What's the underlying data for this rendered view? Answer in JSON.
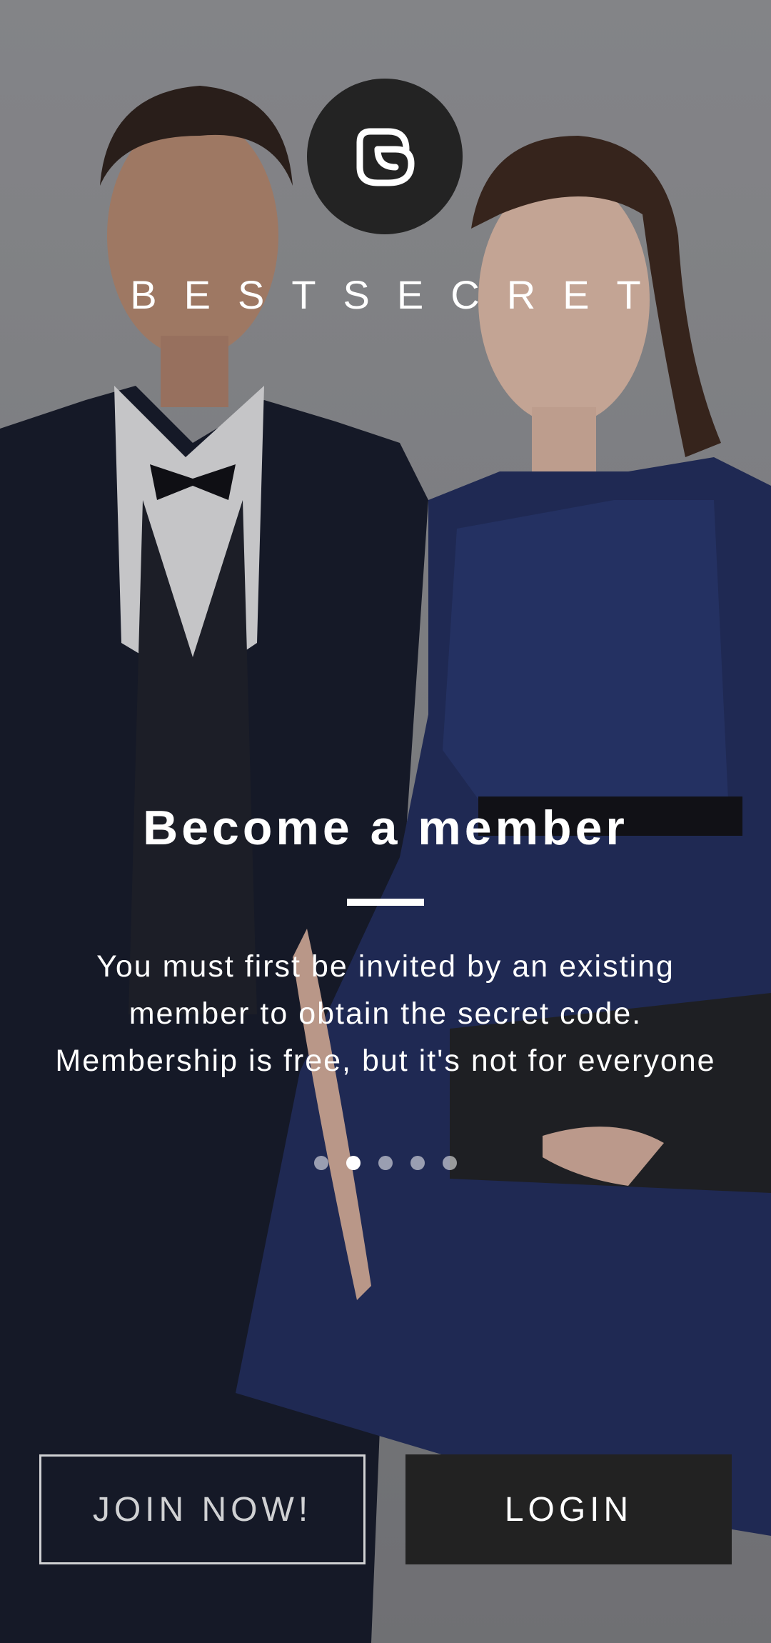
{
  "brand": {
    "name": "BESTSECRET",
    "logo_icon": "bestsecret-knot-logo"
  },
  "onboarding": {
    "headline": "Become a member",
    "description": "You must first be invited by an existing member to obtain the secret code. Membership is free, but it's not for everyone",
    "pages_total": 5,
    "current_page": 2
  },
  "actions": {
    "join_label": "JOIN NOW!",
    "login_label": "LOGIN"
  },
  "colors": {
    "dark_button": "#222222",
    "text": "#ffffff",
    "suit": "#0e1220",
    "dress": "#1e2b5e"
  }
}
